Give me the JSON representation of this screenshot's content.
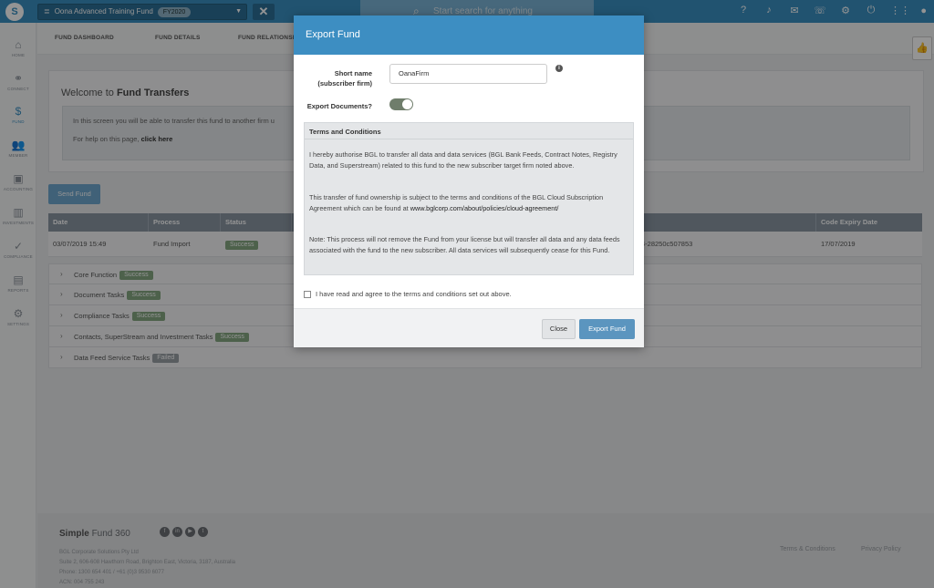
{
  "topbar": {
    "fund_name": "Oona Advanced Training Fund",
    "fy_badge": "FY2020",
    "search_placeholder": "Start search for anything",
    "icons": [
      "help-icon",
      "bell-icon",
      "chat-icon",
      "phone-icon",
      "gear-icon",
      "power-icon",
      "apps-grid-icon",
      "user-icon"
    ]
  },
  "sidebar": {
    "items": [
      {
        "label": "HOME",
        "icon": "home-icon",
        "glyph": "⌂"
      },
      {
        "label": "CONNECT",
        "icon": "connect-icon",
        "glyph": "⚭"
      },
      {
        "label": "FUND",
        "icon": "dollar-icon",
        "glyph": "$"
      },
      {
        "label": "MEMBER",
        "icon": "members-icon",
        "glyph": "👥"
      },
      {
        "label": "ACCOUNTING",
        "icon": "briefcase-icon",
        "glyph": "▣"
      },
      {
        "label": "INVESTMENTS",
        "icon": "chart-icon",
        "glyph": "▥"
      },
      {
        "label": "COMPLIANCE",
        "icon": "check-circle-icon",
        "glyph": "✓"
      },
      {
        "label": "REPORTS",
        "icon": "pdf-icon",
        "glyph": "▤"
      },
      {
        "label": "SETTINGS",
        "icon": "gear-icon",
        "glyph": "⚙"
      }
    ]
  },
  "subnav": {
    "tabs": [
      "FUND DASHBOARD",
      "FUND DETAILS",
      "FUND RELATIONSHIPS"
    ]
  },
  "welcome": {
    "prefix": "Welcome to ",
    "title": "Fund Transfers",
    "line1": "In this screen you will be able to transfer this fund to another firm u",
    "line2_prefix": "For help on this page, ",
    "line2_link": "click here"
  },
  "send_button": "Send Fund",
  "table": {
    "headers": [
      "Date",
      "Process",
      "Status",
      "",
      "Code Expiry Date"
    ],
    "row": {
      "date": "03/07/2019 15:49",
      "process": "Fund Import",
      "status": "Success",
      "code": "4-28250c507853",
      "expiry": "17/07/2019"
    }
  },
  "tasks": [
    {
      "label": "Core Function",
      "status": "Success"
    },
    {
      "label": "Document Tasks",
      "status": "Success"
    },
    {
      "label": "Compliance Tasks",
      "status": "Success"
    },
    {
      "label": "Contacts, SuperStream and Investment Tasks",
      "status": "Success"
    },
    {
      "label": "Data Feed Service Tasks",
      "status": "Failed"
    }
  ],
  "footer": {
    "brand_a": "Simple",
    "brand_b": " Fund 360",
    "company": "BGL Corporate Solutions Pty Ltd",
    "address": "Suite 2, 606-608 Hawthorn Road, Brighton East, Victoria, 3187, Australia",
    "phone": "Phone: 1300 654 401 / +61 (0)3 9530 6077",
    "acn": "ACN: 004 755 243",
    "terms_link": "Terms & Conditions",
    "privacy_link": "Privacy Policy",
    "social": [
      "f",
      "in",
      "▶",
      "t"
    ]
  },
  "modal": {
    "title": "Export Fund",
    "short_name_label_1": "Short name",
    "short_name_label_2": "(subscriber firm)",
    "short_name_value": "OanaFirm",
    "export_docs_label": "Export Documents?",
    "export_docs_on": true,
    "terms_title": "Terms and Conditions",
    "terms_p1": "I hereby authorise BGL to transfer all data and data services (BGL Bank Feeds, Contract Notes, Registry Data, and Superstream) related to this fund to the new subscriber target firm noted above.",
    "terms_p2_prefix": "This transfer of fund ownership is subject to the terms and conditions of the BGL Cloud Subscription Agreement which can be found at ",
    "terms_p2_link": "www.bglcorp.com/about/policies/cloud-agreement/",
    "terms_p3": "Note: This process will not remove the Fund from your license but will transfer all data and any data feeds associated with the fund to the new subscriber. All data services will subsequently cease for this Fund.",
    "agree_label": "I have read and agree to the terms and conditions set out above.",
    "close_button": "Close",
    "export_button": "Export Fund"
  }
}
